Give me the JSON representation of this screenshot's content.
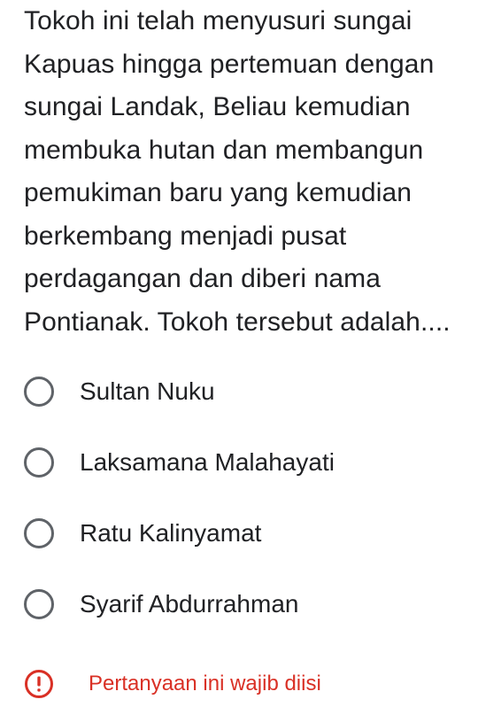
{
  "question": {
    "lines": [
      "Tokoh ini telah menyusuri sungai",
      "Kapuas hingga pertemuan dengan",
      "sungai Landak, Beliau kemudian",
      "membuka hutan dan membangun",
      "pemukiman baru yang kemudian",
      "berkembang menjadi pusat",
      "perdagangan dan diberi nama",
      "Pontianak. Tokoh tersebut adalah...."
    ]
  },
  "options": [
    {
      "label": "Sultan Nuku",
      "selected": false
    },
    {
      "label": "Laksamana Malahayati",
      "selected": false
    },
    {
      "label": "Ratu Kalinyamat",
      "selected": false
    },
    {
      "label": "Syarif Abdurrahman",
      "selected": false
    }
  ],
  "validation": {
    "message": "Pertanyaan ini wajib diisi",
    "icon": "error-exclamation-icon",
    "color": "#d93025"
  },
  "colors": {
    "text": "#202124",
    "radio_border": "#5f6368",
    "error": "#d93025"
  }
}
